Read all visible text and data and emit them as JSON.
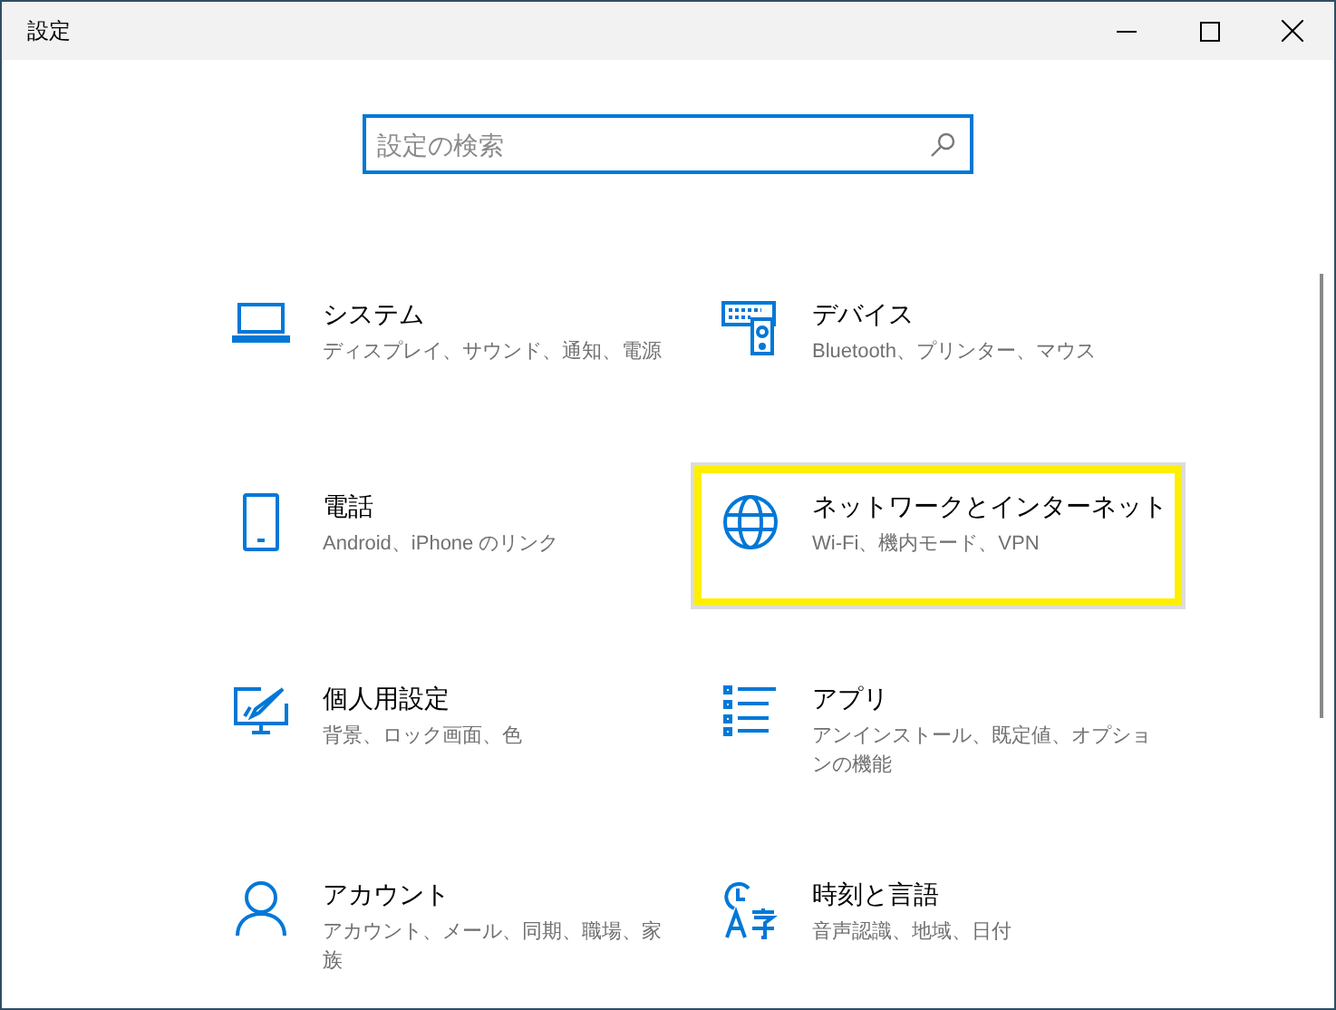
{
  "window": {
    "title": "設定"
  },
  "search": {
    "placeholder": "設定の検索"
  },
  "categories": [
    {
      "kind": "system",
      "title": "システム",
      "description": "ディスプレイ、サウンド、通知、電源",
      "selected": false
    },
    {
      "kind": "devices",
      "title": "デバイス",
      "description": "Bluetooth、プリンター、マウス",
      "selected": false
    },
    {
      "kind": "phone",
      "title": "電話",
      "description": "Android、iPhone のリンク",
      "selected": false
    },
    {
      "kind": "network",
      "title": "ネットワークとインターネット",
      "description": "Wi-Fi、機内モード、VPN",
      "selected": true
    },
    {
      "kind": "personalization",
      "title": "個人用設定",
      "description": "背景、ロック画面、色",
      "selected": false
    },
    {
      "kind": "apps",
      "title": "アプリ",
      "description": "アンインストール、既定値、オプションの機能",
      "selected": false
    },
    {
      "kind": "accounts",
      "title": "アカウント",
      "description": "アカウント、メール、同期、職場、家族",
      "selected": false
    },
    {
      "kind": "time",
      "title": "時刻と言語",
      "description": "音声認識、地域、日付",
      "selected": false
    }
  ]
}
